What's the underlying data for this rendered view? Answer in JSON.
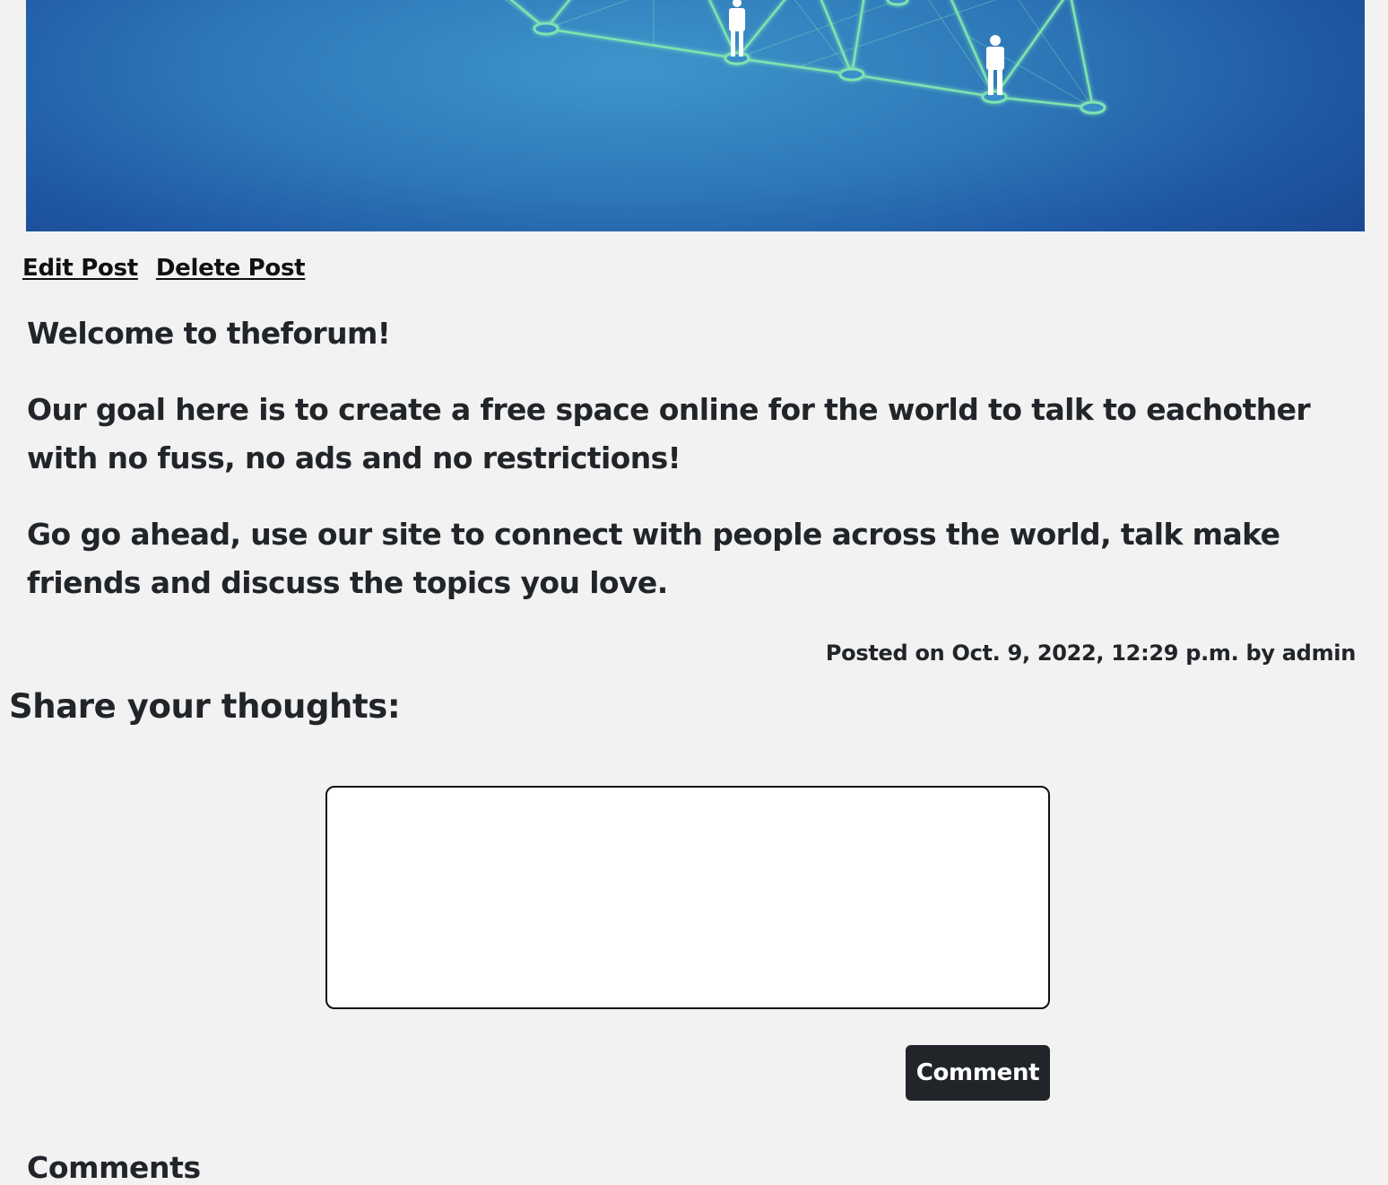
{
  "post": {
    "edit_label": "Edit Post",
    "delete_label": "Delete Post",
    "paragraphs": [
      "Welcome to theforum!",
      "Our goal here is to create a free space online for the world to talk to eachother with no fuss, no ads and no restrictions!",
      "Go go ahead, use our site to connect with people across the world, talk make friends and discuss the topics you love."
    ],
    "meta": "Posted on Oct. 9, 2022, 12:29 p.m. by admin"
  },
  "comment_form": {
    "heading": "Share your thoughts:",
    "textarea_value": "",
    "submit_label": "Comment"
  },
  "comments": {
    "heading": "Comments"
  },
  "colors": {
    "page_background": "#f2f2f2",
    "text": "#212529",
    "button_background": "#212529",
    "hero_blue": "#2d77b7",
    "network_green": "#7fe3b0"
  }
}
